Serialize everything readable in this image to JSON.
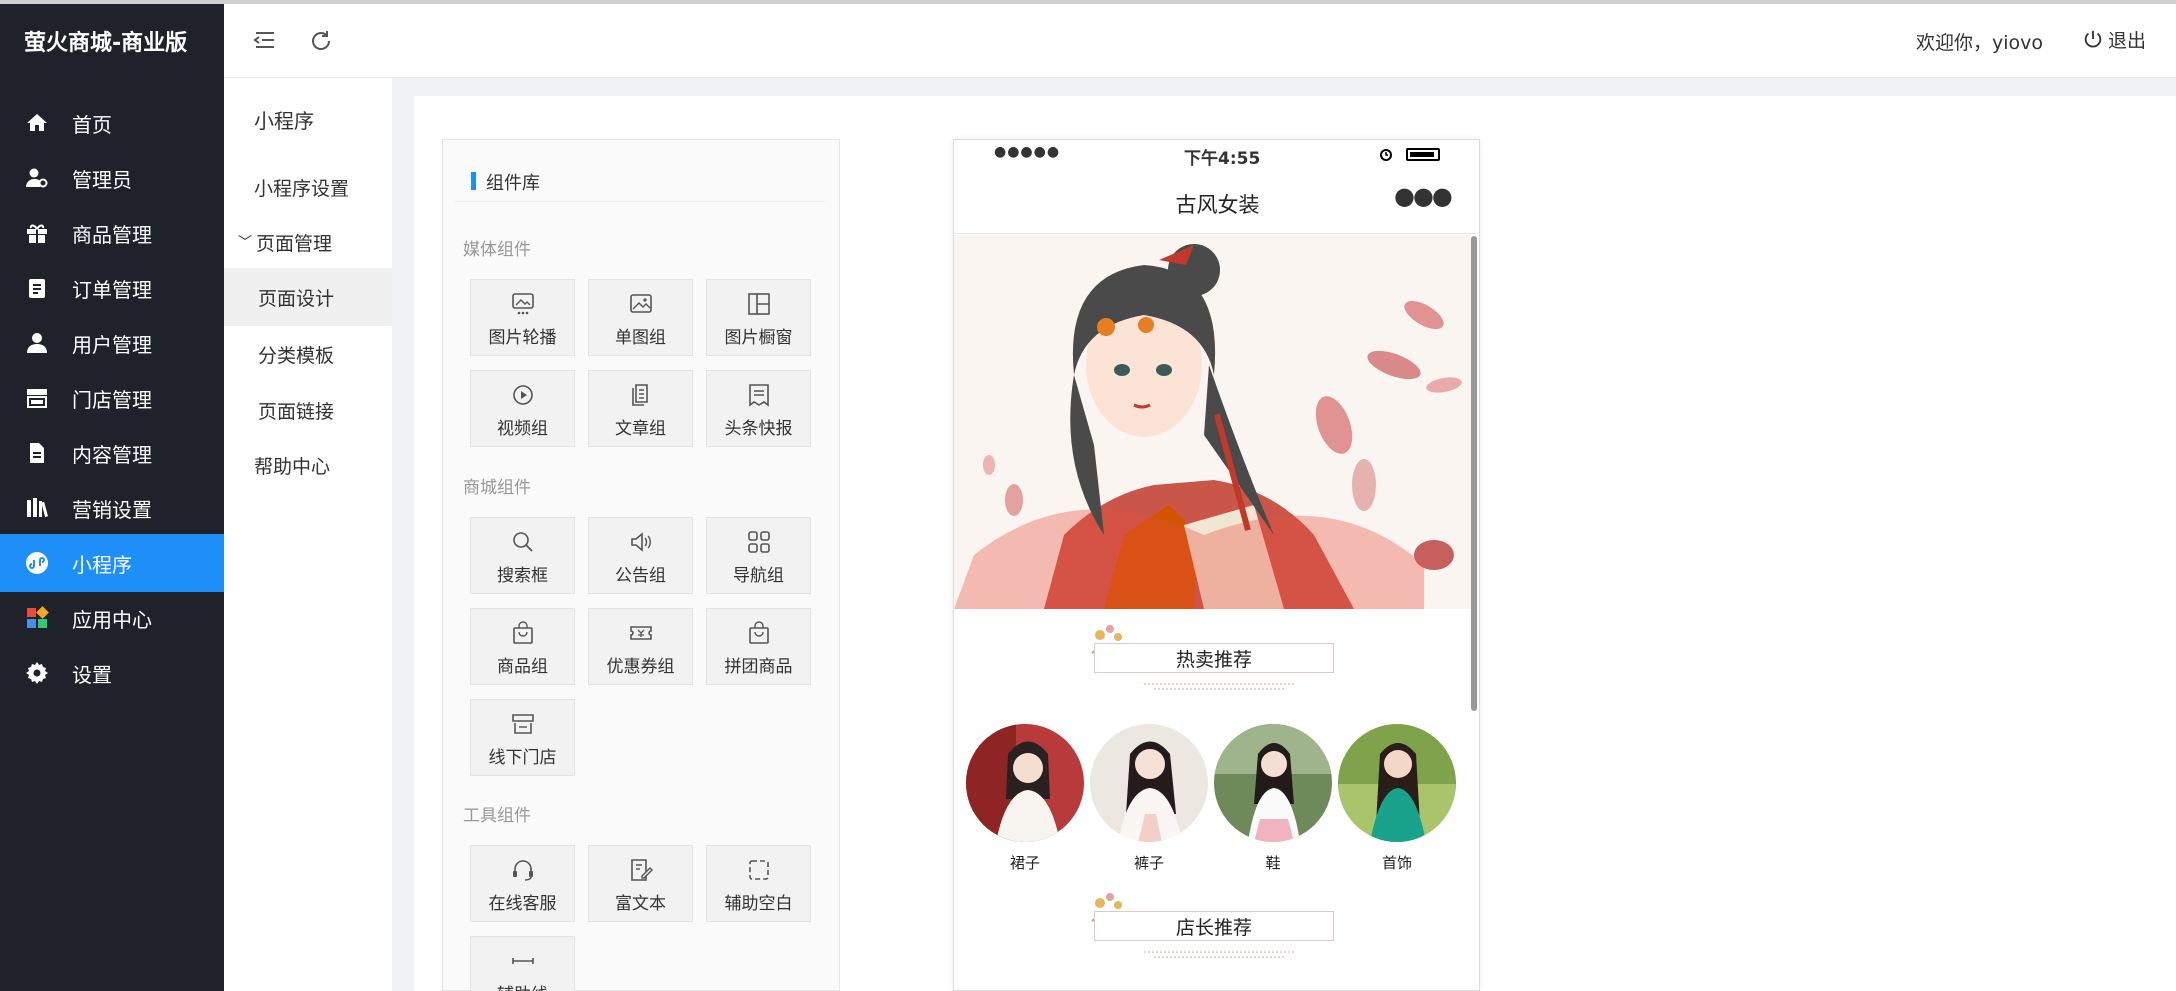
{
  "app": {
    "brand": "萤火商城-商业版"
  },
  "sidebar": {
    "items": [
      {
        "label": "首页",
        "icon": "home-icon"
      },
      {
        "label": "管理员",
        "icon": "admin-icon"
      },
      {
        "label": "商品管理",
        "icon": "gift-icon"
      },
      {
        "label": "订单管理",
        "icon": "clipboard-icon"
      },
      {
        "label": "用户管理",
        "icon": "user-icon"
      },
      {
        "label": "门店管理",
        "icon": "store-icon"
      },
      {
        "label": "内容管理",
        "icon": "document-icon"
      },
      {
        "label": "营销设置",
        "icon": "books-icon"
      },
      {
        "label": "小程序",
        "icon": "miniprogram-icon",
        "active": true
      },
      {
        "label": "应用中心",
        "icon": "apps-icon"
      },
      {
        "label": "设置",
        "icon": "gear-icon"
      }
    ]
  },
  "submenu": {
    "title": "小程序",
    "items": [
      {
        "label": "小程序设置"
      },
      {
        "label": "页面管理",
        "expanded": true
      },
      {
        "label": "页面设计",
        "active": true
      },
      {
        "label": "分类模板"
      },
      {
        "label": "页面链接"
      },
      {
        "label": "帮助中心"
      }
    ]
  },
  "header": {
    "welcome": "欢迎你，yiovo",
    "logout": "退出"
  },
  "library": {
    "title": "组件库",
    "groups": [
      {
        "title": "媒体组件",
        "items": [
          "图片轮播",
          "单图组",
          "图片橱窗",
          "视频组",
          "文章组",
          "头条快报"
        ]
      },
      {
        "title": "商城组件",
        "items": [
          "搜索框",
          "公告组",
          "导航组",
          "商品组",
          "优惠券组",
          "拼团商品",
          "线下门店"
        ]
      },
      {
        "title": "工具组件",
        "items": [
          "在线客服",
          "富文本",
          "辅助空白",
          "辅助线"
        ]
      }
    ]
  },
  "phone": {
    "time": "下午4:55",
    "page_title": "古风女装",
    "section1": "热卖推荐",
    "section2": "店长推荐",
    "categories": [
      "裙子",
      "裤子",
      "鞋",
      "首饰"
    ]
  },
  "colors": {
    "sidebar_bg": "#1f222b",
    "accent": "#1e8ff8"
  }
}
